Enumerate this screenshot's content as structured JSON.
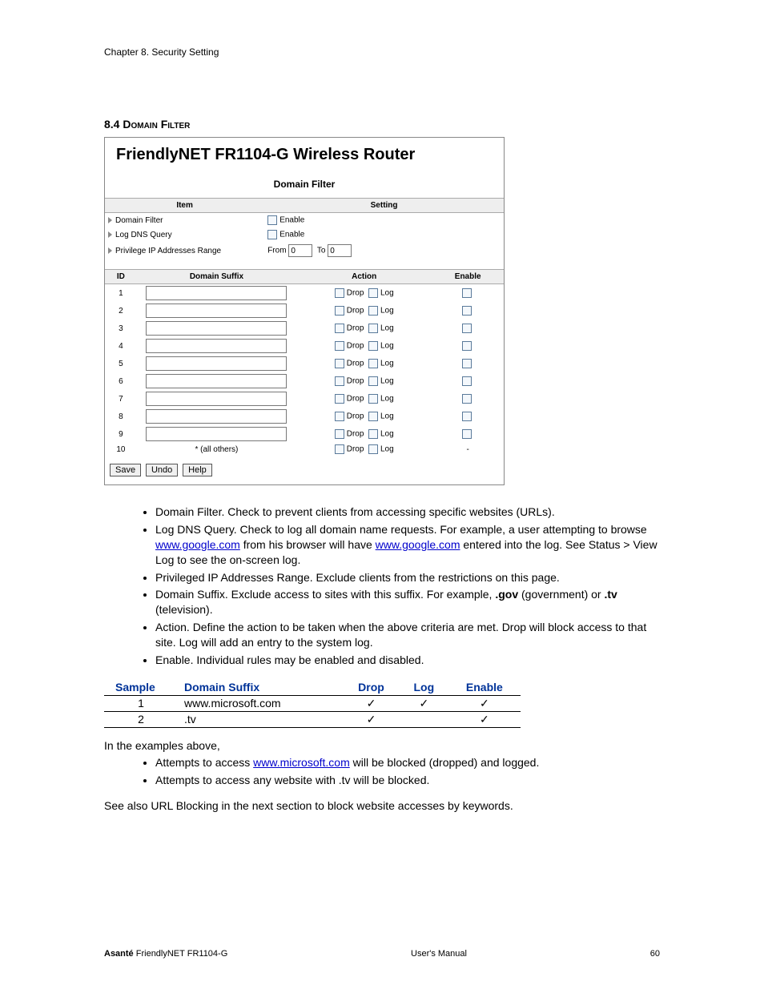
{
  "chapter_header": "Chapter 8. Security Setting",
  "section": {
    "number": "8.4 ",
    "title": "Domain Filter"
  },
  "router": {
    "product_title": "FriendlyNET FR1104-G Wireless Router",
    "panel_title": "Domain Filter",
    "headers": {
      "item": "Item",
      "setting": "Setting",
      "id": "ID",
      "suffix": "Domain Suffix",
      "action": "Action",
      "enable": "Enable"
    },
    "rows": {
      "domain_filter": {
        "label": "Domain Filter",
        "opt": "Enable"
      },
      "log_dns": {
        "label": "Log DNS Query",
        "opt": "Enable"
      },
      "priv_range": {
        "label": "Privilege IP Addresses Range",
        "from": "From",
        "to": "To",
        "from_val": "0",
        "to_val": "0"
      }
    },
    "filter_rows": [
      {
        "id": "1",
        "suffix": "",
        "drop": "Drop",
        "log": "Log",
        "enable_dash": false
      },
      {
        "id": "2",
        "suffix": "",
        "drop": "Drop",
        "log": "Log",
        "enable_dash": false
      },
      {
        "id": "3",
        "suffix": "",
        "drop": "Drop",
        "log": "Log",
        "enable_dash": false
      },
      {
        "id": "4",
        "suffix": "",
        "drop": "Drop",
        "log": "Log",
        "enable_dash": false
      },
      {
        "id": "5",
        "suffix": "",
        "drop": "Drop",
        "log": "Log",
        "enable_dash": false
      },
      {
        "id": "6",
        "suffix": "",
        "drop": "Drop",
        "log": "Log",
        "enable_dash": false
      },
      {
        "id": "7",
        "suffix": "",
        "drop": "Drop",
        "log": "Log",
        "enable_dash": false
      },
      {
        "id": "8",
        "suffix": "",
        "drop": "Drop",
        "log": "Log",
        "enable_dash": false
      },
      {
        "id": "9",
        "suffix": "",
        "drop": "Drop",
        "log": "Log",
        "enable_dash": false
      },
      {
        "id": "10",
        "suffix_text": "* (all others)",
        "drop": "Drop",
        "log": "Log",
        "enable_dash": true
      }
    ],
    "buttons": {
      "save": "Save",
      "undo": "Undo",
      "help": "Help"
    }
  },
  "bullets1": [
    {
      "plain": "Domain Filter. Check to prevent clients from accessing specific websites (URLs)."
    },
    {
      "pre": "Log DNS Query. Check to log all domain name requests. For example, a user attempting to browse ",
      "link1": "www.google.com",
      "mid": " from his browser will have ",
      "link2": "www.google.com",
      "post": " entered into the log. See Status > View Log to see the on-screen log."
    },
    {
      "plain": "Privileged IP Addresses Range. Exclude clients from the restrictions on this page."
    },
    {
      "pre": "Domain Suffix. Exclude access to sites with this suffix. For example, ",
      "b1": ".gov",
      "mid": " (government) or ",
      "b2": ".tv",
      "post": " (television)."
    },
    {
      "plain": "Action. Define the action to be taken when the above criteria are met. Drop will block access to that site. Log will add an entry to the system log."
    },
    {
      "plain": "Enable. Individual rules may be enabled and disabled."
    }
  ],
  "sample_table": {
    "headers": {
      "sample": "Sample",
      "suffix": "Domain Suffix",
      "drop": "Drop",
      "log": "Log",
      "enable": "Enable"
    },
    "rows": [
      {
        "n": "1",
        "suffix": "www.microsoft.com",
        "drop": "✓",
        "log": "✓",
        "enable": "✓"
      },
      {
        "n": "2",
        "suffix": ".tv",
        "drop": "✓",
        "log": "",
        "enable": "✓"
      }
    ]
  },
  "examples_intro": "In the examples above,",
  "bullets2": [
    {
      "pre": "Attempts to access ",
      "link": "www.microsoft.com",
      "post": " will be blocked (dropped) and logged."
    },
    {
      "plain": "Attempts to access any website with .tv will be blocked."
    }
  ],
  "closing": "See also URL Blocking in the next section to block website accesses by keywords.",
  "footer": {
    "left_bold": "Asanté",
    "left_rest": " FriendlyNET FR1104-G",
    "center": "User's Manual",
    "right": "60"
  }
}
